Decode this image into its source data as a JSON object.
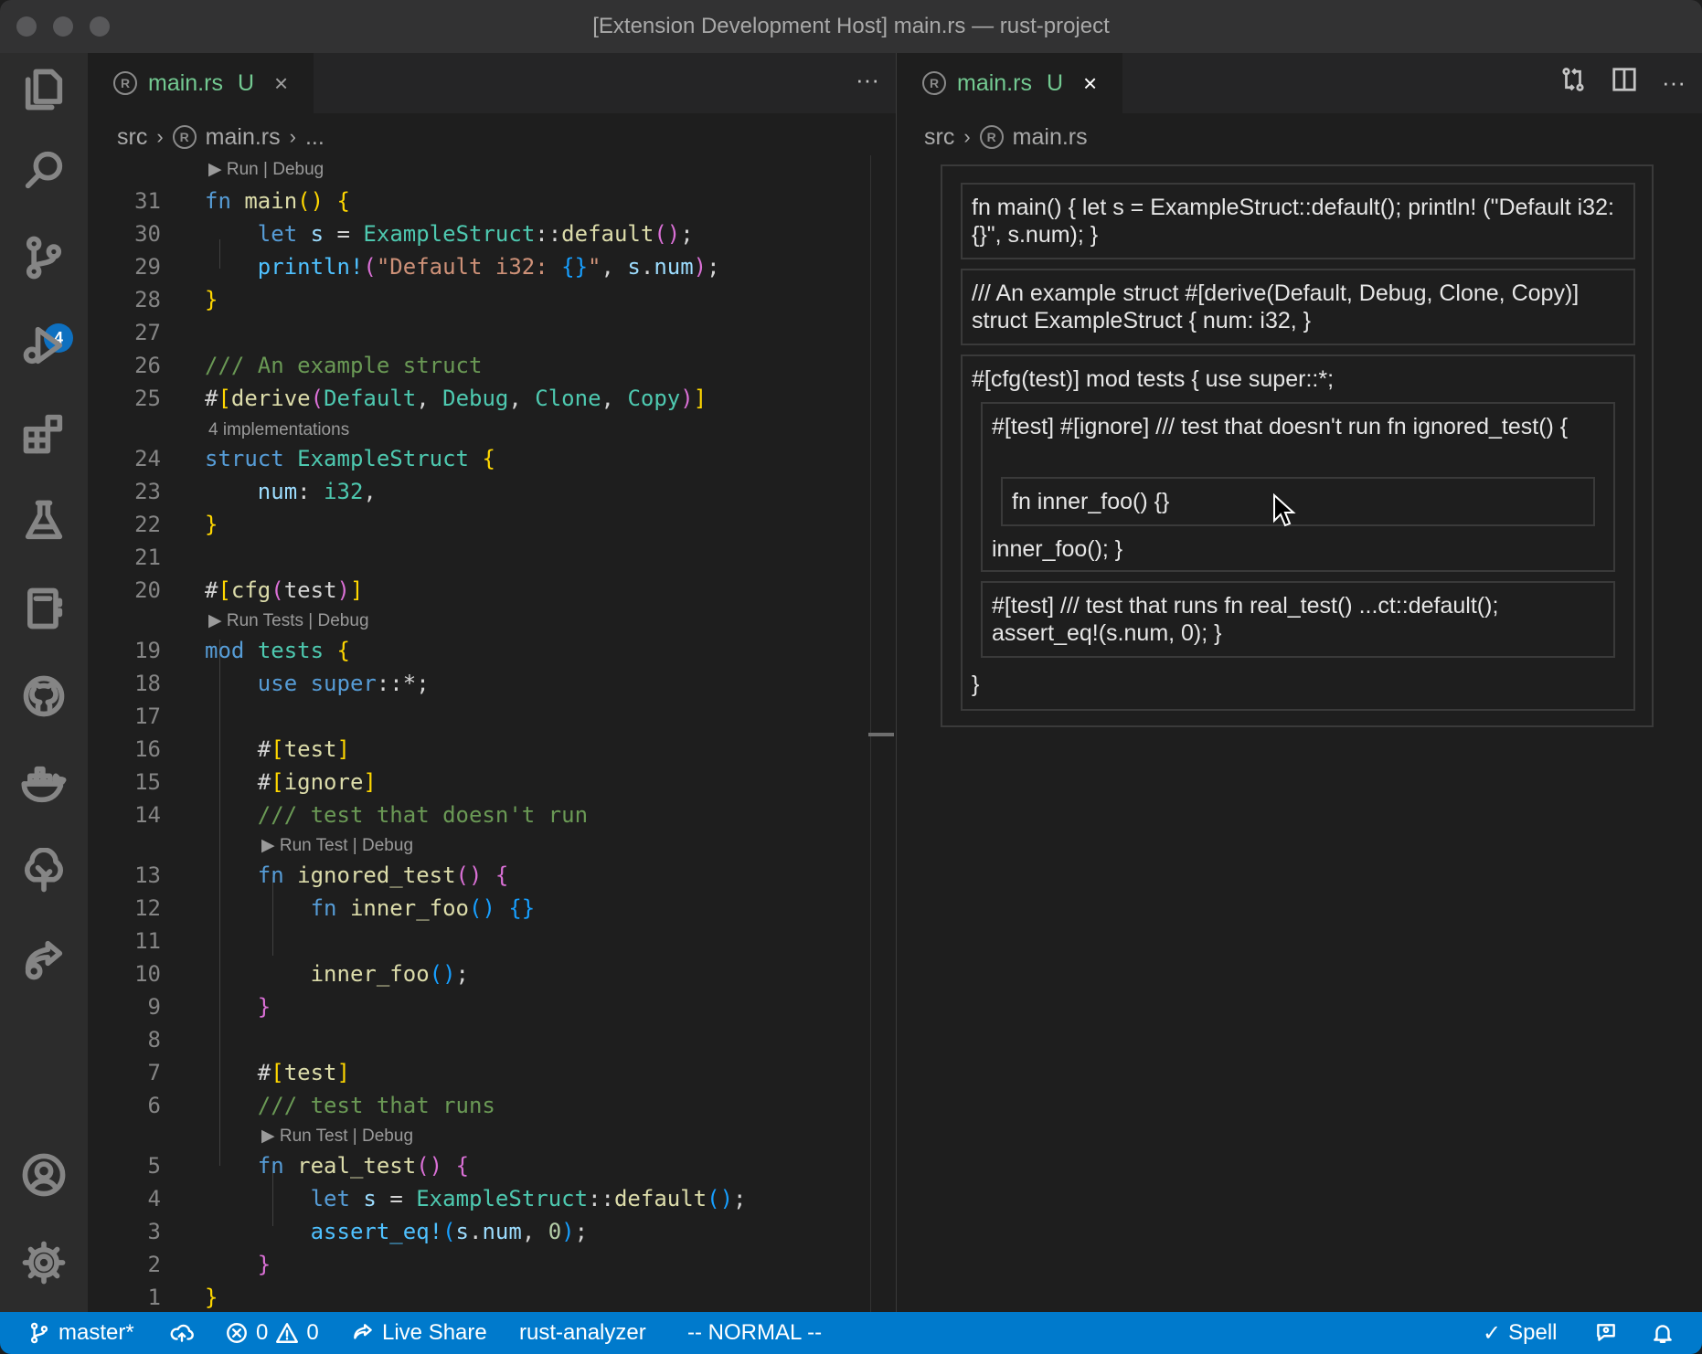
{
  "window": {
    "title": "[Extension Development Host] main.rs — rust-project"
  },
  "activity_bar": {
    "items": [
      "files-icon",
      "search-icon",
      "source-control-icon",
      "run-debug-icon",
      "extensions-icon",
      "testing-icon",
      "notebook-icon",
      "github-icon",
      "docker-icon",
      "tree-icon",
      "live-share-icon"
    ],
    "source_control_badge": "4",
    "bottom": [
      "account-icon",
      "settings-gear-icon"
    ]
  },
  "left_editor": {
    "tab": {
      "name": "main.rs",
      "status": "U",
      "close": "×",
      "more": "···"
    },
    "breadcrumb": [
      "src",
      "main.rs",
      "..."
    ],
    "lenses": {
      "main": "▶ Run | Debug",
      "impls": "4 implementations",
      "tests_mod": "▶ Run Tests | Debug",
      "ignored_test": "▶ Run Test | Debug",
      "real_test": "▶ Run Test | Debug"
    },
    "line_numbers": [
      "31",
      "30",
      "29",
      "28",
      "27",
      "26",
      "25",
      "24",
      "23",
      "22",
      "21",
      "20",
      "19",
      "18",
      "17",
      "16",
      "15",
      "14",
      "13",
      "12",
      "11",
      "10",
      "9",
      "8",
      "7",
      "6",
      "5",
      "4",
      "3",
      "2",
      "1"
    ]
  },
  "right_editor": {
    "tab": {
      "name": "main.rs",
      "status": "U",
      "close": "×",
      "more": "···"
    },
    "breadcrumb": [
      "src",
      "main.rs"
    ],
    "blocks": {
      "main": "fn main() { let s = ExampleStruct::default(); println! (\"Default i32: {}\", s.num); }",
      "struct": "/// An example struct #[derive(Default, Debug, Clone, Copy)] struct ExampleStruct { num: i32, }",
      "tests_head": "#[cfg(test)] mod tests { use super::*;",
      "ignored_head": "#[test] #[ignore] /// test that doesn't run fn ignored_test() {",
      "inner_foo": "fn inner_foo() {}",
      "ignored_tail": "inner_foo(); }",
      "real_test": "#[test] /// test that runs fn real_test() ...ct::default(); assert_eq!(s.num, 0); }",
      "tests_tail": "}"
    }
  },
  "status_bar": {
    "branch": "master*",
    "errors": "0",
    "warnings": "0",
    "live_share": "Live Share",
    "language_server": "rust-analyzer",
    "mode": "-- NORMAL --",
    "spell": "Spell"
  }
}
